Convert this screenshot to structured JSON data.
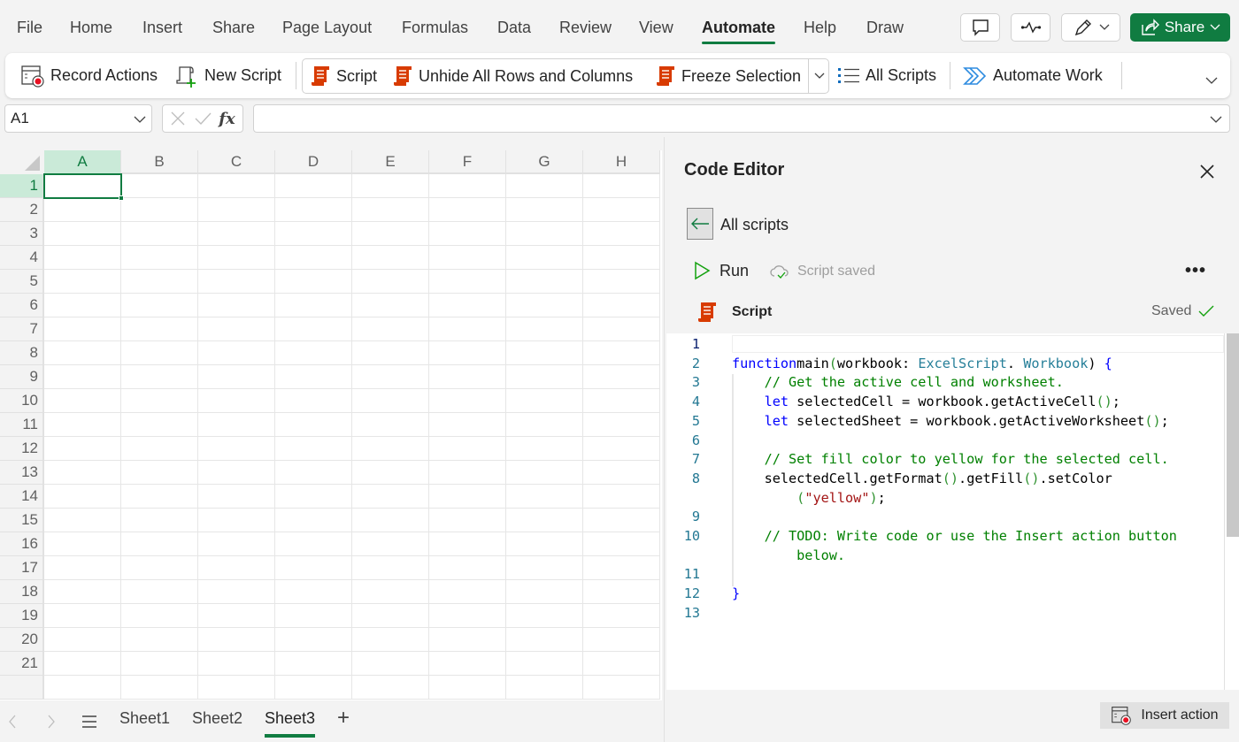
{
  "menu": {
    "tabs": [
      {
        "label": "File",
        "active": false
      },
      {
        "label": "Home",
        "active": false
      },
      {
        "label": "Insert",
        "active": false
      },
      {
        "label": "Share",
        "active": false
      },
      {
        "label": "Page Layout",
        "active": false
      },
      {
        "label": "Formulas",
        "active": false
      },
      {
        "label": "Data",
        "active": false
      },
      {
        "label": "Review",
        "active": false
      },
      {
        "label": "View",
        "active": false
      },
      {
        "label": "Automate",
        "active": true
      },
      {
        "label": "Help",
        "active": false
      },
      {
        "label": "Draw",
        "active": false
      }
    ],
    "comments_icon": "comment-icon",
    "activity_icon": "activity-icon",
    "editing_icon": "pencil-icon",
    "share_label": "Share",
    "accent_color": "#107c41"
  },
  "ribbon": {
    "record_actions": "Record Actions",
    "new_script": "New Script",
    "gallery": [
      "Script",
      "Unhide All Rows and Columns",
      "Freeze Selection"
    ],
    "all_scripts": "All Scripts",
    "automate_work": "Automate Work"
  },
  "formula_bar": {
    "name_box": "A1",
    "formula_value": ""
  },
  "grid": {
    "columns": [
      "A",
      "B",
      "C",
      "D",
      "E",
      "F",
      "G",
      "H"
    ],
    "rows": [
      "1",
      "2",
      "3",
      "4",
      "5",
      "6",
      "7",
      "8",
      "9",
      "10",
      "11",
      "12",
      "13",
      "14",
      "15",
      "16",
      "17",
      "18",
      "19",
      "20",
      "21"
    ],
    "active_cell": "A1"
  },
  "sheets": {
    "tabs": [
      {
        "label": "Sheet1",
        "active": false
      },
      {
        "label": "Sheet2",
        "active": false
      },
      {
        "label": "Sheet3",
        "active": true
      }
    ],
    "add_label": "+"
  },
  "editor": {
    "title": "Code Editor",
    "back_label": "All scripts",
    "run_label": "Run",
    "save_status": "Script saved",
    "more_label": "•••",
    "script_name": "Script",
    "saved_label": "Saved",
    "insert_action_label": "Insert action",
    "code_lines": [
      {
        "n": "1",
        "tokens": []
      },
      {
        "n": "2",
        "tokens": [
          [
            "kw",
            "function"
          ],
          [
            "",
            "main"
          ],
          [
            "br",
            "("
          ],
          [
            "",
            "workbook: "
          ],
          [
            "ty",
            "ExcelScript"
          ],
          [
            "",
            ". "
          ],
          [
            "ty",
            "Workbook"
          ],
          [
            "",
            ") "
          ],
          [
            "kw",
            "{"
          ]
        ]
      },
      {
        "n": "3",
        "tokens": [
          [
            "",
            "    "
          ],
          [
            "cm",
            "// Get the active cell and worksheet."
          ]
        ]
      },
      {
        "n": "4",
        "tokens": [
          [
            "",
            "    "
          ],
          [
            "kw",
            "let"
          ],
          [
            "",
            " selectedCell = workbook.getActiveCell"
          ],
          [
            "br",
            "()"
          ],
          [
            "",
            ";"
          ]
        ]
      },
      {
        "n": "5",
        "tokens": [
          [
            "",
            "    "
          ],
          [
            "kw",
            "let"
          ],
          [
            "",
            " selectedSheet = workbook.getActiveWorksheet"
          ],
          [
            "br",
            "()"
          ],
          [
            "",
            ";"
          ]
        ]
      },
      {
        "n": "6",
        "tokens": []
      },
      {
        "n": "7",
        "tokens": [
          [
            "",
            "    "
          ],
          [
            "cm",
            "// Set fill color to yellow for the selected cell."
          ]
        ]
      },
      {
        "n": "8",
        "tokens": [
          [
            "",
            "    selectedCell.getFormat"
          ],
          [
            "br",
            "()"
          ],
          [
            "",
            ".getFill"
          ],
          [
            "br",
            "()"
          ],
          [
            "",
            ".setColor"
          ]
        ]
      },
      {
        "n": "",
        "tokens": [
          [
            "",
            "        "
          ],
          [
            "br",
            "("
          ],
          [
            "st",
            "\"yellow\""
          ],
          [
            "br",
            ")"
          ],
          [
            "",
            ";"
          ]
        ]
      },
      {
        "n": "9",
        "tokens": []
      },
      {
        "n": "10",
        "tokens": [
          [
            "",
            "    "
          ],
          [
            "cm",
            "// TODO: Write code or use the Insert action button"
          ]
        ]
      },
      {
        "n": "",
        "tokens": [
          [
            "",
            "        "
          ],
          [
            "cm",
            "below."
          ]
        ]
      },
      {
        "n": "11",
        "tokens": []
      },
      {
        "n": "12",
        "tokens": [
          [
            "kw",
            "}"
          ]
        ]
      },
      {
        "n": "13",
        "tokens": []
      }
    ]
  }
}
